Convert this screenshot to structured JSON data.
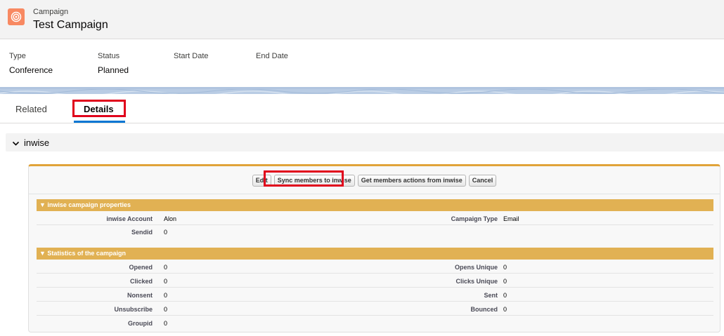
{
  "header": {
    "object_label": "Campaign",
    "title": "Test Campaign"
  },
  "highlights": [
    {
      "label": "Type",
      "value": "Conference"
    },
    {
      "label": "Status",
      "value": "Planned"
    },
    {
      "label": "Start Date",
      "value": ""
    },
    {
      "label": "End Date",
      "value": ""
    }
  ],
  "tabs": [
    {
      "label": "Related"
    },
    {
      "label": "Details"
    }
  ],
  "section": {
    "label": "inwise"
  },
  "buttons": [
    {
      "label": "Edit"
    },
    {
      "label": "Sync members to inwise"
    },
    {
      "label": "Get members actions from inwise"
    },
    {
      "label": "Cancel"
    }
  ],
  "properties": {
    "title": "inwise campaign properties",
    "rows": [
      {
        "l1": "inwise Account",
        "v1": "Alon",
        "l2": "Campaign Type",
        "v2": "Email"
      },
      {
        "l1": "Sendid",
        "v1": "0",
        "l2": "",
        "v2": ""
      }
    ]
  },
  "statistics": {
    "title": "Statistics of the campaign",
    "rows": [
      {
        "l1": "Opened",
        "v1": "0",
        "l2": "Opens Unique",
        "v2": "0"
      },
      {
        "l1": "Clicked",
        "v1": "0",
        "l2": "Clicks Unique",
        "v2": "0"
      },
      {
        "l1": "Nonsent",
        "v1": "0",
        "l2": "Sent",
        "v2": "0"
      },
      {
        "l1": "Unsubscribe",
        "v1": "0",
        "l2": "Bounced",
        "v2": "0"
      },
      {
        "l1": "Groupid",
        "v1": "0",
        "l2": "",
        "v2": ""
      }
    ]
  },
  "colors": {
    "brand_icon": "#f88962",
    "active_tab": "#0176d3",
    "highlight_box": "#e0001b",
    "section_bar": "#e1b153"
  }
}
